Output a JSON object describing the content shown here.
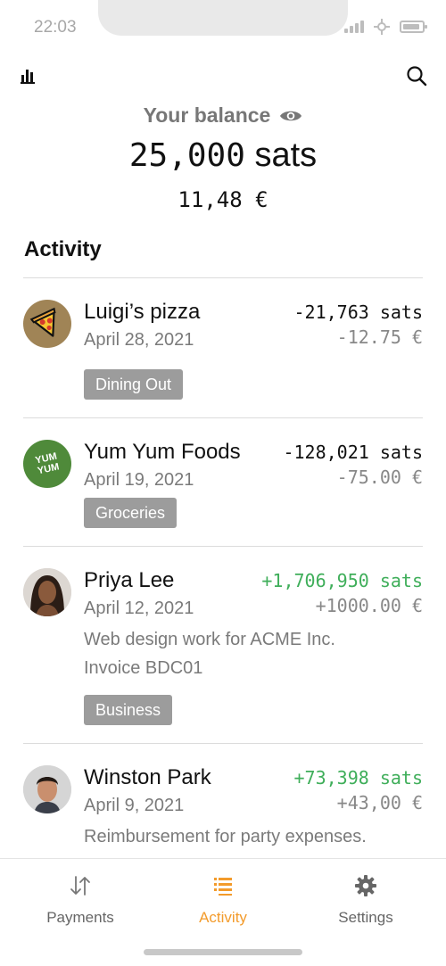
{
  "status_bar": {
    "time": "22:03"
  },
  "balance": {
    "label": "Your balance",
    "amount": "25,000",
    "unit": "sats",
    "fiat": "11,48 €"
  },
  "activity": {
    "title": "Activity",
    "transactions": [
      {
        "name": "Luigi’s pizza",
        "date": "April 28, 2021",
        "sats": "-21,763 sats",
        "fiat": "-12.75 €",
        "tag": "Dining Out",
        "avatar": "pizza-icon"
      },
      {
        "name": "Yum Yum Foods",
        "date": "April 19, 2021",
        "sats": "-128,021 sats",
        "fiat": "-75.00 €",
        "tag": "Groceries",
        "avatar_text": "YUM YUM"
      },
      {
        "name": "Priya Lee",
        "date": "April 12, 2021",
        "sats": "+1,706,950 sats",
        "fiat": "+1000.00 €",
        "note_line1": "Web design work for ACME Inc.",
        "note_line2": "Invoice BDC01",
        "tag": "Business",
        "avatar": "person-photo"
      },
      {
        "name": "Winston Park",
        "date": "April 9, 2021",
        "sats": "+73,398 sats",
        "fiat": "+43,00 €",
        "note_line1": "Reimbursement for party expenses.",
        "avatar": "person-photo"
      }
    ]
  },
  "nav": {
    "items": [
      {
        "label": "Payments",
        "icon": "transfer-arrows-icon"
      },
      {
        "label": "Activity",
        "icon": "list-icon"
      },
      {
        "label": "Settings",
        "icon": "gear-icon"
      }
    ],
    "active": "Activity"
  },
  "colors": {
    "accent": "#f39b2b",
    "positive": "#3fae5a",
    "tag_bg": "#9c9c9c"
  }
}
